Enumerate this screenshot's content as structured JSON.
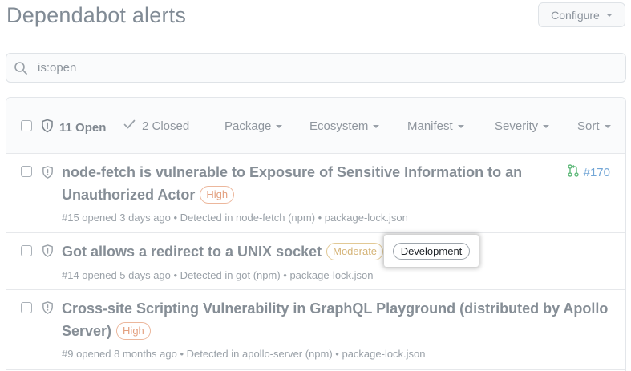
{
  "page": {
    "title": "Dependabot alerts"
  },
  "configure": {
    "label": "Configure"
  },
  "search": {
    "value": "is:open",
    "icon": "search-icon"
  },
  "header": {
    "open_label": "11 Open",
    "closed_label": "2 Closed",
    "filters": [
      "Package",
      "Ecosystem",
      "Manifest",
      "Severity",
      "Sort"
    ]
  },
  "alerts": [
    {
      "title": "node-fetch is vulnerable to Exposure of Sensitive Information to an Unauthorized Actor",
      "title_line1": "node-fetch is vulnerable to Exposure of Sensitive Information to an",
      "title_line2": "Unauthorized Actor",
      "severity": "High",
      "meta": "#15 opened 3 days ago • Detected in node-fetch (npm) • package-lock.json",
      "pr": "#170"
    },
    {
      "title": "Got allows a redirect to a UNIX socket",
      "severity": "Moderate",
      "label": "Development",
      "meta": "#14 opened 5 days ago • Detected in got (npm) • package-lock.json"
    },
    {
      "title": "Cross-site Scripting Vulnerability in GraphQL Playground (distributed by Apollo Server)",
      "title_line1": "Cross-site Scripting Vulnerability in GraphQL Playground (distributed by Apollo",
      "title_line2": "Server)",
      "severity": "High",
      "meta": "#9 opened 8 months ago • Detected in apollo-server (npm) • package-lock.json"
    }
  ],
  "colors": {
    "high": "#e3a07f",
    "moderate": "#d5b478",
    "link": "#72a6d6",
    "pr_icon": "#5fb97a"
  }
}
